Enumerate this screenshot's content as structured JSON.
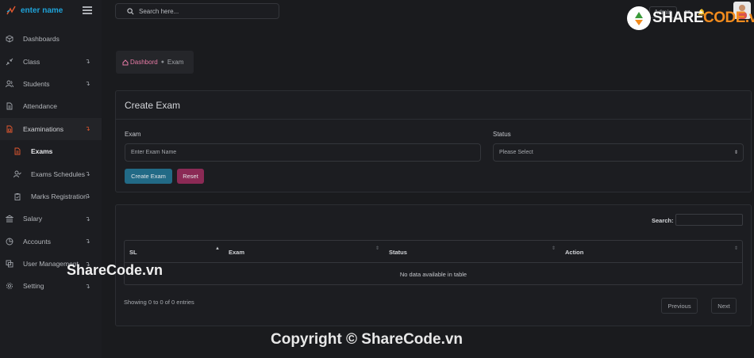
{
  "brand": {
    "name": "enter name"
  },
  "sidebar": {
    "items": [
      {
        "label": "Dashboards",
        "icon": "cube-icon",
        "arrow": ""
      },
      {
        "label": "Class",
        "icon": "compress-icon",
        "arrow": "↴"
      },
      {
        "label": "Students",
        "icon": "users-icon",
        "arrow": "↴"
      },
      {
        "label": "Attendance",
        "icon": "document-icon",
        "arrow": ""
      },
      {
        "label": "Examinations",
        "icon": "exam-icon",
        "arrow": "↴"
      },
      {
        "label": "Exams",
        "icon": "file-icon",
        "arrow": ""
      },
      {
        "label": "Exams Schedules",
        "icon": "user-check-icon",
        "arrow": "↴"
      },
      {
        "label": "Marks Registration",
        "icon": "clipboard-icon",
        "arrow": "↴"
      },
      {
        "label": "Salary",
        "icon": "bank-icon",
        "arrow": "↴"
      },
      {
        "label": "Accounts",
        "icon": "pie-chart-icon",
        "arrow": "↴"
      },
      {
        "label": "User Management",
        "icon": "copy-icon",
        "arrow": "↴"
      },
      {
        "label": "Setting",
        "icon": "gear-icon",
        "arrow": "↴"
      }
    ]
  },
  "topbar": {
    "search_placeholder": "Search here...",
    "admin_label": "Admin"
  },
  "breadcrumb": {
    "home": "Dashbord",
    "current": "Exam"
  },
  "form": {
    "title": "Create Exam",
    "exam_label": "Exam",
    "exam_placeholder": "Enter Exam Name",
    "status_label": "Status",
    "status_selected": "Please Select",
    "create_button": "Create Exam",
    "reset_button": "Reset"
  },
  "table": {
    "search_label": "Search:",
    "columns": [
      "SL",
      "Exam",
      "Status",
      "Action"
    ],
    "empty_text": "No data available in table",
    "showing_text": "Showing 0 to 0 of 0 entries",
    "prev_label": "Previous",
    "next_label": "Next"
  },
  "watermarks": {
    "logo_prefix": "SHARE",
    "logo_suffix": "CODE.vn",
    "middle": "ShareCode.vn",
    "bottom": "Copyright © ShareCode.vn"
  },
  "colors": {
    "accent_blue": "#226a86",
    "accent_pink": "#8b2a55",
    "active_orange": "#e3582f",
    "brand_blue": "#1fa3d9"
  }
}
